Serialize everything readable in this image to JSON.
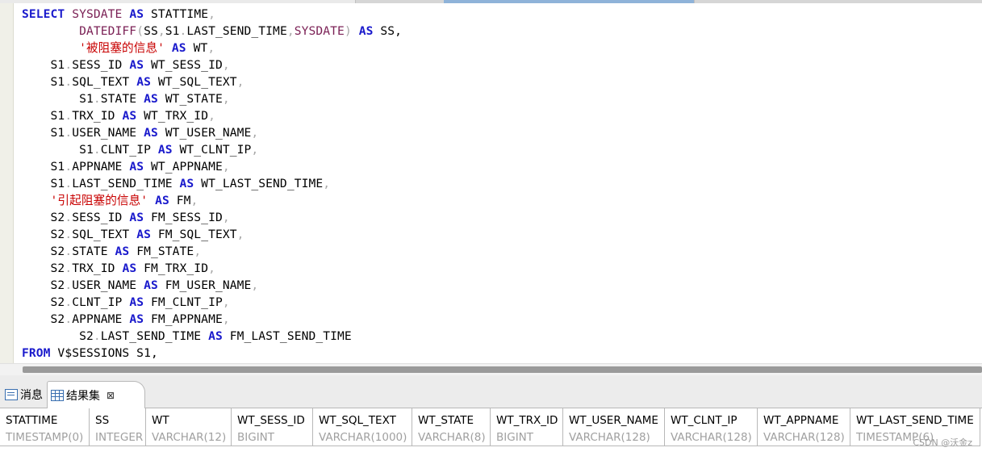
{
  "editor": {
    "lines": [
      [
        {
          "t": "SELECT",
          "c": "kw"
        },
        {
          "t": " "
        },
        {
          "t": "SYSDATE",
          "c": "fn"
        },
        {
          "t": " "
        },
        {
          "t": "AS",
          "c": "kw"
        },
        {
          "t": " STATTIME"
        },
        {
          "t": ",",
          "c": "punct"
        }
      ],
      [
        {
          "t": "        "
        },
        {
          "t": "DATEDIFF",
          "c": "fn"
        },
        {
          "t": "(",
          "c": "punct"
        },
        {
          "t": "SS"
        },
        {
          "t": ",",
          "c": "punct"
        },
        {
          "t": "S1"
        },
        {
          "t": ".",
          "c": "punct"
        },
        {
          "t": "LAST_SEND_TIME"
        },
        {
          "t": ",",
          "c": "punct"
        },
        {
          "t": "SYSDATE",
          "c": "fn"
        },
        {
          "t": ")",
          "c": "punct"
        },
        {
          "t": " "
        },
        {
          "t": "AS",
          "c": "kw"
        },
        {
          "t": " SS,"
        }
      ],
      [
        {
          "t": "        "
        },
        {
          "t": "'被阻塞的信息'",
          "c": "str"
        },
        {
          "t": " "
        },
        {
          "t": "AS",
          "c": "kw"
        },
        {
          "t": " WT"
        },
        {
          "t": ",",
          "c": "punct"
        }
      ],
      [
        {
          "t": "    S1"
        },
        {
          "t": ".",
          "c": "punct"
        },
        {
          "t": "SESS_ID "
        },
        {
          "t": "AS",
          "c": "kw"
        },
        {
          "t": " WT_SESS_ID"
        },
        {
          "t": ",",
          "c": "punct"
        }
      ],
      [
        {
          "t": "    S1"
        },
        {
          "t": ".",
          "c": "punct"
        },
        {
          "t": "SQL_TEXT "
        },
        {
          "t": "AS",
          "c": "kw"
        },
        {
          "t": " WT_SQL_TEXT"
        },
        {
          "t": ",",
          "c": "punct"
        }
      ],
      [
        {
          "t": "        S1"
        },
        {
          "t": ".",
          "c": "punct"
        },
        {
          "t": "STATE "
        },
        {
          "t": "AS",
          "c": "kw"
        },
        {
          "t": " WT_STATE"
        },
        {
          "t": ",",
          "c": "punct"
        }
      ],
      [
        {
          "t": "    S1"
        },
        {
          "t": ".",
          "c": "punct"
        },
        {
          "t": "TRX_ID "
        },
        {
          "t": "AS",
          "c": "kw"
        },
        {
          "t": " WT_TRX_ID"
        },
        {
          "t": ",",
          "c": "punct"
        }
      ],
      [
        {
          "t": "    S1"
        },
        {
          "t": ".",
          "c": "punct"
        },
        {
          "t": "USER_NAME "
        },
        {
          "t": "AS",
          "c": "kw"
        },
        {
          "t": " WT_USER_NAME"
        },
        {
          "t": ",",
          "c": "punct"
        }
      ],
      [
        {
          "t": "        S1"
        },
        {
          "t": ".",
          "c": "punct"
        },
        {
          "t": "CLNT_IP "
        },
        {
          "t": "AS",
          "c": "kw"
        },
        {
          "t": " WT_CLNT_IP"
        },
        {
          "t": ",",
          "c": "punct"
        }
      ],
      [
        {
          "t": "    S1"
        },
        {
          "t": ".",
          "c": "punct"
        },
        {
          "t": "APPNAME "
        },
        {
          "t": "AS",
          "c": "kw"
        },
        {
          "t": " WT_APPNAME"
        },
        {
          "t": ",",
          "c": "punct"
        }
      ],
      [
        {
          "t": "    S1"
        },
        {
          "t": ".",
          "c": "punct"
        },
        {
          "t": "LAST_SEND_TIME "
        },
        {
          "t": "AS",
          "c": "kw"
        },
        {
          "t": " WT_LAST_SEND_TIME"
        },
        {
          "t": ",",
          "c": "punct"
        }
      ],
      [
        {
          "t": "    "
        },
        {
          "t": "'引起阻塞的信息'",
          "c": "str"
        },
        {
          "t": " "
        },
        {
          "t": "AS",
          "c": "kw"
        },
        {
          "t": " FM"
        },
        {
          "t": ",",
          "c": "punct"
        }
      ],
      [
        {
          "t": "    S2"
        },
        {
          "t": ".",
          "c": "punct"
        },
        {
          "t": "SESS_ID "
        },
        {
          "t": "AS",
          "c": "kw"
        },
        {
          "t": " FM_SESS_ID"
        },
        {
          "t": ",",
          "c": "punct"
        }
      ],
      [
        {
          "t": "    S2"
        },
        {
          "t": ".",
          "c": "punct"
        },
        {
          "t": "SQL_TEXT "
        },
        {
          "t": "AS",
          "c": "kw"
        },
        {
          "t": " FM_SQL_TEXT"
        },
        {
          "t": ",",
          "c": "punct"
        }
      ],
      [
        {
          "t": "    S2"
        },
        {
          "t": ".",
          "c": "punct"
        },
        {
          "t": "STATE "
        },
        {
          "t": "AS",
          "c": "kw"
        },
        {
          "t": " FM_STATE"
        },
        {
          "t": ",",
          "c": "punct"
        }
      ],
      [
        {
          "t": "    S2"
        },
        {
          "t": ".",
          "c": "punct"
        },
        {
          "t": "TRX_ID "
        },
        {
          "t": "AS",
          "c": "kw"
        },
        {
          "t": " FM_TRX_ID"
        },
        {
          "t": ",",
          "c": "punct"
        }
      ],
      [
        {
          "t": "    S2"
        },
        {
          "t": ".",
          "c": "punct"
        },
        {
          "t": "USER_NAME "
        },
        {
          "t": "AS",
          "c": "kw"
        },
        {
          "t": " FM_USER_NAME"
        },
        {
          "t": ",",
          "c": "punct"
        }
      ],
      [
        {
          "t": "    S2"
        },
        {
          "t": ".",
          "c": "punct"
        },
        {
          "t": "CLNT_IP "
        },
        {
          "t": "AS",
          "c": "kw"
        },
        {
          "t": " FM_CLNT_IP"
        },
        {
          "t": ",",
          "c": "punct"
        }
      ],
      [
        {
          "t": "    S2"
        },
        {
          "t": ".",
          "c": "punct"
        },
        {
          "t": "APPNAME "
        },
        {
          "t": "AS",
          "c": "kw"
        },
        {
          "t": " FM_APPNAME"
        },
        {
          "t": ",",
          "c": "punct"
        }
      ],
      [
        {
          "t": "        S2"
        },
        {
          "t": ".",
          "c": "punct"
        },
        {
          "t": "LAST_SEND_TIME "
        },
        {
          "t": "AS",
          "c": "kw"
        },
        {
          "t": " FM_LAST_SEND_TIME"
        }
      ],
      [
        {
          "t": "FROM",
          "c": "kw"
        },
        {
          "t": " V$SESSIONS S1,"
        }
      ]
    ]
  },
  "panel": {
    "tab_messages": "消息",
    "tab_results": "结果集",
    "close_glyph": "⊠"
  },
  "results": {
    "columns": [
      {
        "name": "STATTIME",
        "type": "TIMESTAMP(0)"
      },
      {
        "name": "SS",
        "type": "INTEGER"
      },
      {
        "name": "WT",
        "type": "VARCHAR(12)"
      },
      {
        "name": "WT_SESS_ID",
        "type": "BIGINT"
      },
      {
        "name": "WT_SQL_TEXT",
        "type": "VARCHAR(1000)"
      },
      {
        "name": "WT_STATE",
        "type": "VARCHAR(8)"
      },
      {
        "name": "WT_TRX_ID",
        "type": "BIGINT"
      },
      {
        "name": "WT_USER_NAME",
        "type": "VARCHAR(128)"
      },
      {
        "name": "WT_CLNT_IP",
        "type": "VARCHAR(128)"
      },
      {
        "name": "WT_APPNAME",
        "type": "VARCHAR(128)"
      },
      {
        "name": "WT_LAST_SEND_TIME",
        "type": "TIMESTAMP(6)"
      }
    ]
  },
  "watermark": "CSDN @沃金z",
  "colors": {
    "keyword": "#1a1acc",
    "function": "#7a1f54",
    "string": "#c80000",
    "punctuation": "#a8a8a8"
  }
}
